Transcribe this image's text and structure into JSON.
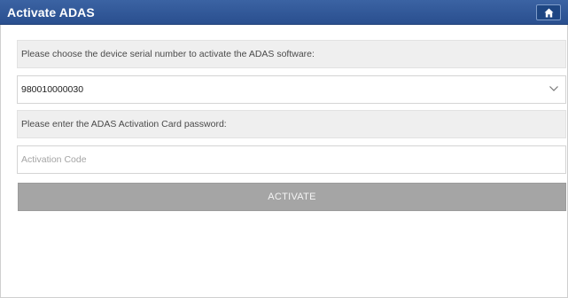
{
  "window": {
    "title": "Activate ADAS",
    "home_icon": "home-icon"
  },
  "form": {
    "serial_prompt": "Please choose the device serial number to activate the ADAS software:",
    "serial_selected": "980010000030",
    "dropdown_icon": "chevron-down-icon",
    "password_prompt": "Please enter the ADAS Activation Card password:",
    "activation_code_placeholder": "Activation Code",
    "activate_label": "ACTIVATE"
  },
  "colors": {
    "titlebar": "#2f5797",
    "label_background": "#efefef",
    "button_disabled": "#a5a5a5"
  }
}
